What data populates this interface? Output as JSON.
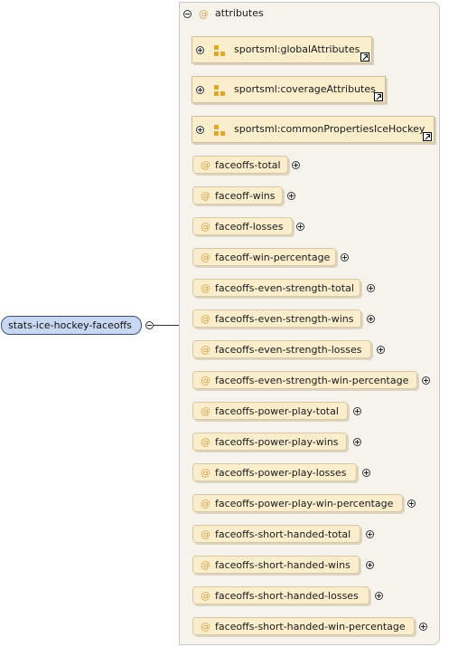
{
  "root_element": {
    "label": "stats-ice-hockey-faceoffs"
  },
  "attributes_box": {
    "title": "attributes",
    "at_symbol": "@"
  },
  "groups": [
    {
      "label": "sportsml:globalAttributes"
    },
    {
      "label": "sportsml:coverageAttributes"
    },
    {
      "label": "sportsml:commonPropertiesIceHockey"
    }
  ],
  "attributes": [
    {
      "label": "faceoffs-total"
    },
    {
      "label": "faceoff-wins"
    },
    {
      "label": "faceoff-losses"
    },
    {
      "label": "faceoff-win-percentage"
    },
    {
      "label": "faceoffs-even-strength-total"
    },
    {
      "label": "faceoffs-even-strength-wins"
    },
    {
      "label": "faceoffs-even-strength-losses"
    },
    {
      "label": "faceoffs-even-strength-win-percentage"
    },
    {
      "label": "faceoffs-power-play-total"
    },
    {
      "label": "faceoffs-power-play-wins"
    },
    {
      "label": "faceoffs-power-play-losses"
    },
    {
      "label": "faceoffs-power-play-win-percentage"
    },
    {
      "label": "faceoffs-short-handed-total"
    },
    {
      "label": "faceoffs-short-handed-wins"
    },
    {
      "label": "faceoffs-short-handed-losses"
    },
    {
      "label": "faceoffs-short-handed-win-percentage"
    }
  ]
}
